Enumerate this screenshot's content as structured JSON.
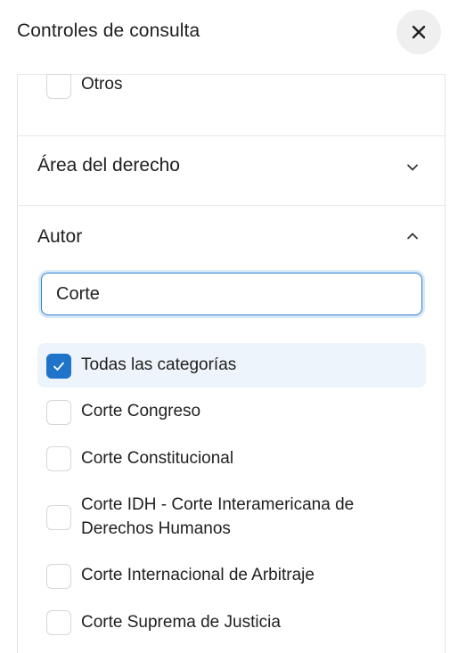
{
  "header": {
    "title": "Controles de consulta",
    "close_icon": "close-icon"
  },
  "top_options": [
    {
      "label": "Otros",
      "checked": false
    }
  ],
  "sections": {
    "area": {
      "title": "Área del derecho",
      "expanded": false,
      "icon": "chevron-down-icon"
    },
    "autor": {
      "title": "Autor",
      "expanded": true,
      "icon": "chevron-up-icon",
      "search": {
        "value": "Corte",
        "placeholder": ""
      },
      "options": [
        {
          "label": "Todas las categorías",
          "checked": true
        },
        {
          "label": "Corte Congreso",
          "checked": false
        },
        {
          "label": "Corte Constitucional",
          "checked": false
        },
        {
          "label": "Corte IDH - Corte Interamericana de Derechos Humanos",
          "line1": "Corte IDH - Corte Interamericana de",
          "line2": "Derechos Humanos",
          "checked": false
        },
        {
          "label": "Corte Internacional de Arbitraje",
          "checked": false
        },
        {
          "label": "Corte Suprema de Justicia",
          "checked": false
        }
      ]
    }
  },
  "colors": {
    "accent": "#1f74c9",
    "selected_row": "#eef4fb",
    "close_bg": "#efefef"
  }
}
